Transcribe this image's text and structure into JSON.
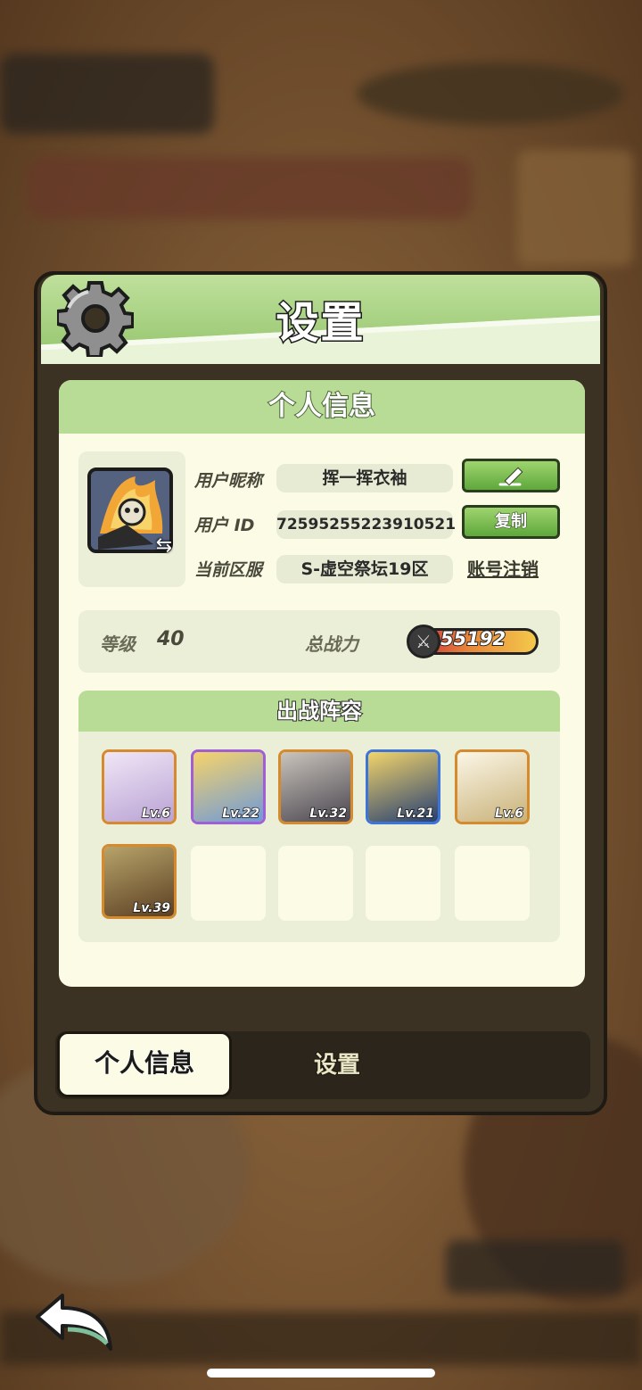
{
  "panel": {
    "title": "设置"
  },
  "profile_card": {
    "header": "个人信息",
    "nickname_label": "用户昵称",
    "nickname": "挥一挥衣袖",
    "user_id_label": "用户 ID",
    "user_id": "72595255223910521",
    "server_label": "当前区服",
    "server": "S-虚空祭坛19区",
    "copy_button": "复制",
    "cancel_account_link": "账号注销",
    "level_label": "等级",
    "level": "40",
    "power_label": "总战力",
    "power": "55192"
  },
  "lineup": {
    "header": "出战阵容",
    "heroes": [
      {
        "level": "Lv.6",
        "frame": "orange",
        "color": "#d9c7e8"
      },
      {
        "level": "Lv.22",
        "frame": "purple",
        "color": "#7aa0d6"
      },
      {
        "level": "Lv.32",
        "frame": "orange",
        "color": "#6d6a72"
      },
      {
        "level": "Lv.21",
        "frame": "blue",
        "color": "#2f4c86"
      },
      {
        "level": "Lv.6",
        "frame": "orange",
        "color": "#e6dfc8"
      },
      {
        "level": "Lv.39",
        "frame": "orange",
        "color": "#8a6a3c"
      }
    ]
  },
  "tabs": {
    "personal_info": "个人信息",
    "settings": "设置"
  },
  "icons": {
    "gear": "gear-icon",
    "edit": "pencil-icon",
    "swap": "swap-icon",
    "power": "crossed-swords-icon",
    "back": "back-arrow-icon"
  },
  "colors": {
    "accent_green": "#93c46b",
    "card_bg": "#fbfbe6",
    "panel_dark": "#3b3224"
  }
}
